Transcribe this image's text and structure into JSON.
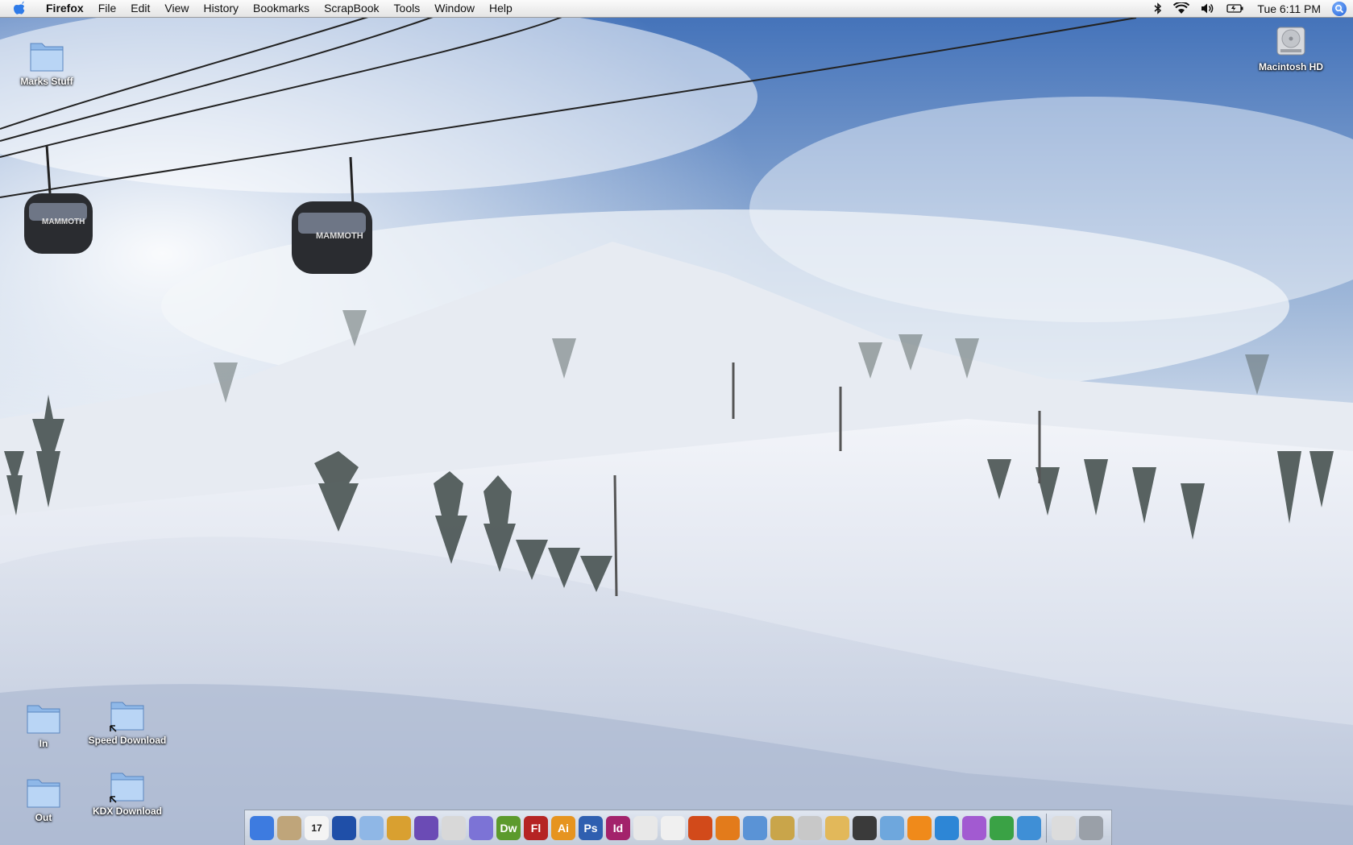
{
  "menubar": {
    "apple_icon": "apple-logo-icon",
    "app_name": "Firefox",
    "items": [
      "File",
      "Edit",
      "View",
      "History",
      "Bookmarks",
      "ScrapBook",
      "Tools",
      "Window",
      "Help"
    ],
    "status_icons": [
      "bluetooth-icon",
      "wifi-icon",
      "volume-icon",
      "battery-icon"
    ],
    "clock": "Tue 6:11 PM",
    "spotlight_icon": "spotlight-search-icon"
  },
  "desktop": {
    "wallpaper": "snowy ski slope with gondolas",
    "gondola_text": "MAMMOTH",
    "icons": [
      {
        "label": "Marks Stuff",
        "icon": "folder-icon"
      },
      {
        "label": "Macintosh HD",
        "icon": "hard-drive-icon"
      },
      {
        "label": "In",
        "icon": "folder-icon"
      },
      {
        "label": "Speed Download",
        "icon": "folder-alias-icon"
      },
      {
        "label": "Out",
        "icon": "folder-icon"
      },
      {
        "label": "KDX Download",
        "icon": "folder-alias-icon"
      }
    ]
  },
  "dock": {
    "apps": [
      {
        "name": "finder-icon",
        "text": "",
        "color": "#3d7be0"
      },
      {
        "name": "mail-bird-icon",
        "text": "",
        "color": "#bfa57a"
      },
      {
        "name": "calendar-icon",
        "text": "17",
        "color": "#f4f4f4"
      },
      {
        "name": "google-earth-icon",
        "text": "",
        "color": "#1f4fa8"
      },
      {
        "name": "dashboard-grid-icon",
        "text": "",
        "color": "#8fb7e6"
      },
      {
        "name": "x11-icon",
        "text": "",
        "color": "#d9a030"
      },
      {
        "name": "wizard-figure-icon",
        "text": "",
        "color": "#6b4bb5"
      },
      {
        "name": "preview-icon",
        "text": "",
        "color": "#d8d8d8"
      },
      {
        "name": "image-stack-icon",
        "text": "",
        "color": "#7c73d6"
      },
      {
        "name": "dreamweaver-icon",
        "text": "Dw",
        "color": "#5c9a2c"
      },
      {
        "name": "flash-icon",
        "text": "Fl",
        "color": "#b52424"
      },
      {
        "name": "illustrator-icon",
        "text": "Ai",
        "color": "#e69420"
      },
      {
        "name": "photoshop-icon",
        "text": "Ps",
        "color": "#2f5fb0"
      },
      {
        "name": "indesign-icon",
        "text": "Id",
        "color": "#a3226b"
      },
      {
        "name": "acrobat-icon",
        "text": "",
        "color": "#e8e8e8"
      },
      {
        "name": "acrobat-reader-icon",
        "text": "",
        "color": "#f0f0f0"
      },
      {
        "name": "flame-icon",
        "text": "",
        "color": "#d24a1a"
      },
      {
        "name": "firefox-icon",
        "text": "",
        "color": "#e37b1b"
      },
      {
        "name": "safari-compass-icon",
        "text": "",
        "color": "#5a93d6"
      },
      {
        "name": "gold-swirl-icon",
        "text": "",
        "color": "#c9a54a"
      },
      {
        "name": "scanner-figure-icon",
        "text": "",
        "color": "#c8c8c8"
      },
      {
        "name": "package-icon",
        "text": "",
        "color": "#e2b85a"
      },
      {
        "name": "film-clapper-icon",
        "text": "",
        "color": "#3a3a3a"
      },
      {
        "name": "itunes-icon",
        "text": "",
        "color": "#6ea7dd"
      },
      {
        "name": "vlc-cone-icon",
        "text": "",
        "color": "#f08a1a"
      },
      {
        "name": "quicktime-icon",
        "text": "",
        "color": "#2d86d6"
      },
      {
        "name": "app-purple-icon",
        "text": "",
        "color": "#a25ad1"
      },
      {
        "name": "frog-icon",
        "text": "",
        "color": "#3aa245"
      },
      {
        "name": "waves-icon",
        "text": "",
        "color": "#3f8fd6"
      }
    ],
    "docked_extras": [
      {
        "name": "downloads-stack-icon",
        "color": "#dcdcdc"
      },
      {
        "name": "trash-icon",
        "color": "#9aa0a8"
      }
    ]
  }
}
